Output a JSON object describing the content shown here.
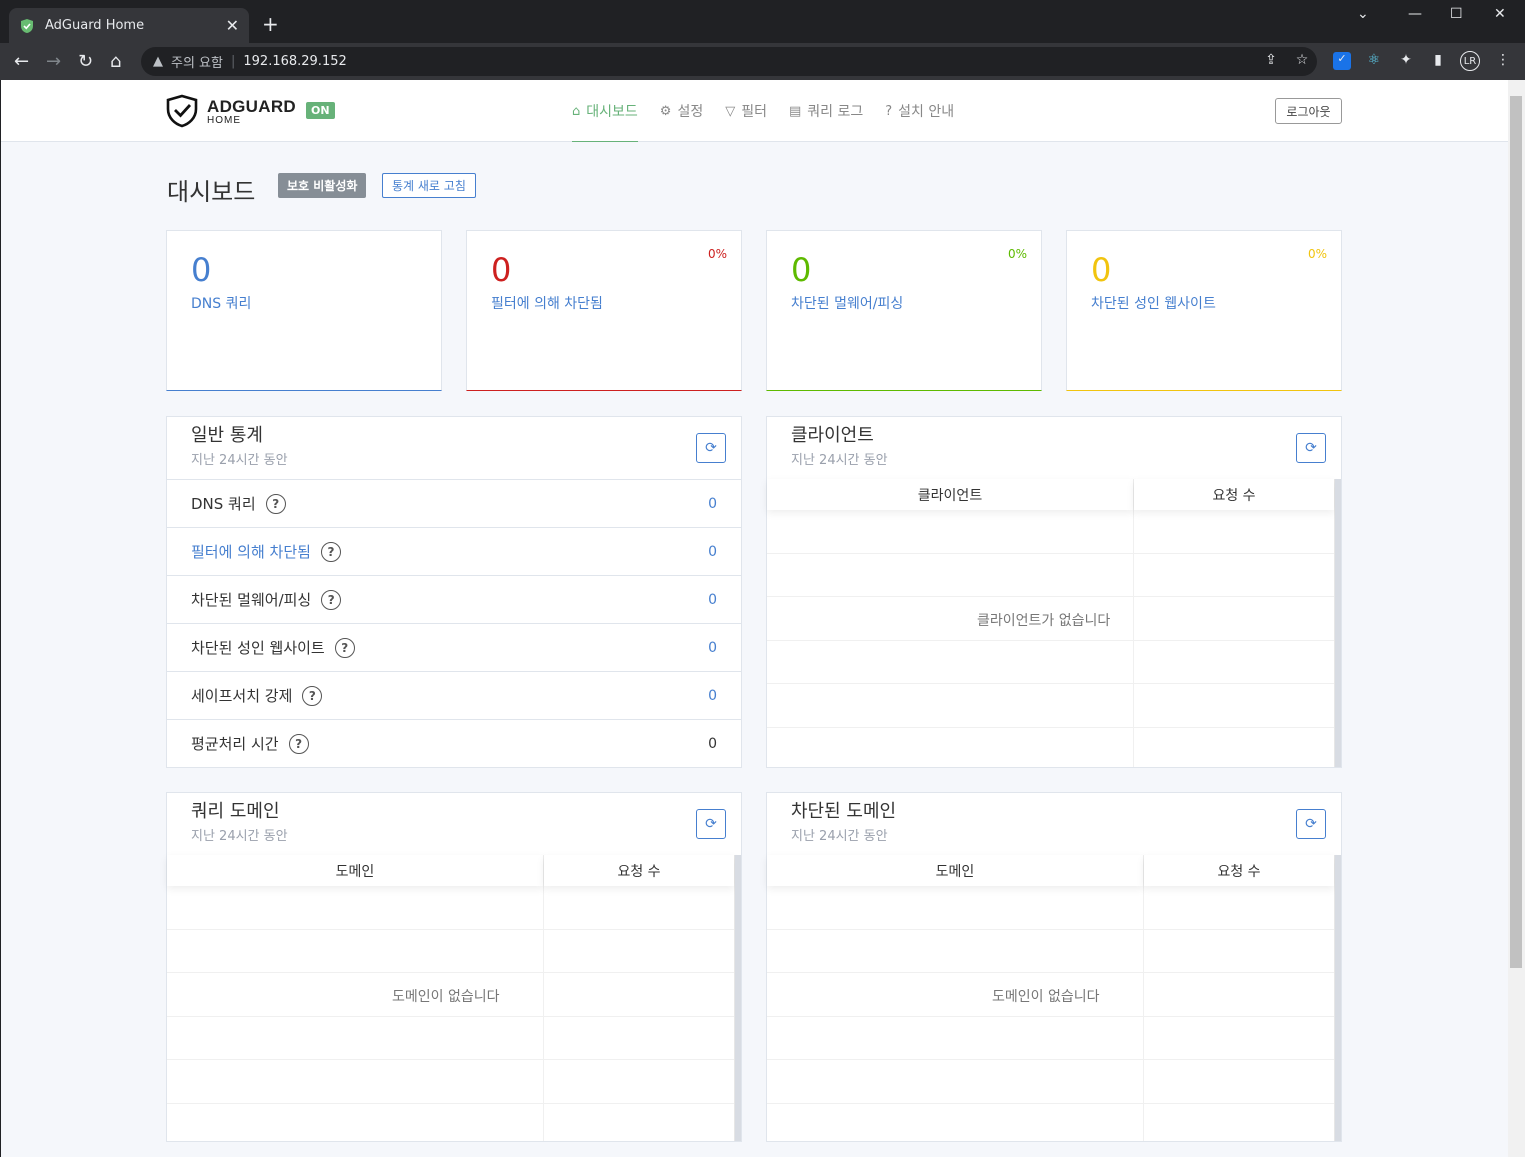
{
  "browser": {
    "tab_title": "AdGuard Home",
    "new_tab_symbol": "+",
    "address_warning": "주의 요함",
    "address_url": "192.168.29.152",
    "profile_initials": "LR"
  },
  "header": {
    "brand_top": "ADGUARD",
    "brand_bottom": "HOME",
    "status_badge": "ON",
    "nav": [
      {
        "label": "대시보드",
        "icon": "home-icon"
      },
      {
        "label": "설정",
        "icon": "gear-icon"
      },
      {
        "label": "필터",
        "icon": "filter-icon"
      },
      {
        "label": "쿼리 로그",
        "icon": "document-icon"
      },
      {
        "label": "설치 안내",
        "icon": "help-icon"
      }
    ],
    "logout_label": "로그아웃"
  },
  "dashboard": {
    "title": "대시보드",
    "disable_protection_label": "보호 비활성화",
    "refresh_stats_label": "통계 새로 고침"
  },
  "stat_cards": [
    {
      "value": "0",
      "label": "DNS 쿼리",
      "percent": "",
      "color": "#467fcf"
    },
    {
      "value": "0",
      "label": "필터에 의해 차단됨",
      "percent": "0%",
      "color": "#cd201f"
    },
    {
      "value": "0",
      "label": "차단된 멀웨어/피싱",
      "percent": "0%",
      "color": "#5eba00"
    },
    {
      "value": "0",
      "label": "차단된 성인 웹사이트",
      "percent": "0%",
      "color": "#f1c40f"
    }
  ],
  "general_stats": {
    "title": "일반 통계",
    "subtitle": "지난 24시간 동안",
    "rows": [
      {
        "label": "DNS 쿼리",
        "value": "0"
      },
      {
        "label": "필터에 의해 차단됨",
        "value": "0"
      },
      {
        "label": "차단된 멀웨어/피싱",
        "value": "0"
      },
      {
        "label": "차단된 성인 웹사이트",
        "value": "0"
      },
      {
        "label": "세이프서치 강제",
        "value": "0"
      },
      {
        "label": "평균처리 시간",
        "value": "0"
      }
    ],
    "help_symbol": "?"
  },
  "clients": {
    "title": "클라이언트",
    "subtitle": "지난 24시간 동안",
    "col1": "클라이언트",
    "col2": "요청 수",
    "empty": "클라이언트가 없습니다"
  },
  "query_domains": {
    "title": "쿼리 도메인",
    "subtitle": "지난 24시간 동안",
    "col1": "도메인",
    "col2": "요청 수",
    "empty": "도메인이 없습니다"
  },
  "blocked_domains": {
    "title": "차단된 도메인",
    "subtitle": "지난 24시간 동안",
    "col1": "도메인",
    "col2": "요청 수",
    "empty": "도메인이 없습니다"
  }
}
